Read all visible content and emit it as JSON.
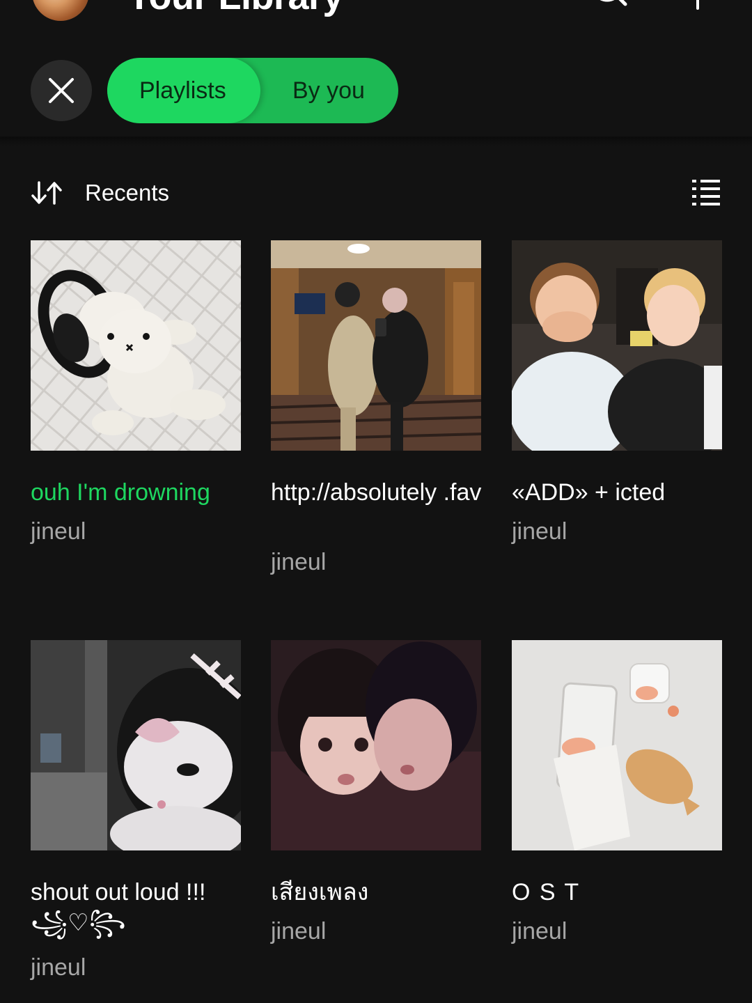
{
  "header": {
    "title": "Your Library",
    "avatar_icon": "user-avatar",
    "search_icon": "search-icon",
    "add_icon": "plus-icon"
  },
  "filters": {
    "close_icon": "close-icon",
    "chips": [
      {
        "label": "Playlists",
        "selected": true
      },
      {
        "label": "By you",
        "selected": true
      }
    ],
    "accent": "#1ed760"
  },
  "sort": {
    "label": "Recents",
    "sort_icon": "sort-arrows-icon",
    "view_icon": "list-view-icon"
  },
  "playlists": [
    {
      "title": "ouh I'm drowning",
      "owner": "jineul",
      "playing": true
    },
    {
      "title": "http://absolutely .fav",
      "owner": "jineul",
      "playing": false
    },
    {
      "title": "«ADD» + icted",
      "owner": "jineul",
      "playing": false
    },
    {
      "title": "shout out loud !!! ꧁♡꧂",
      "owner": "jineul",
      "playing": false
    },
    {
      "title": "เสียงเพลง",
      "owner": "jineul",
      "playing": false
    },
    {
      "title": "O S T",
      "owner": "jineul",
      "playing": false
    }
  ],
  "colors": {
    "background": "#121212",
    "text_primary": "#ffffff",
    "text_secondary": "#a7a7a7"
  }
}
